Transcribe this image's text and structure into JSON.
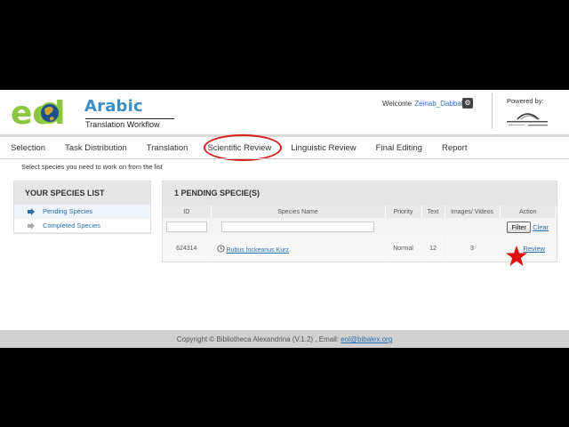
{
  "header": {
    "logo_text": "eol",
    "logo_arabic": "Arabic",
    "logo_subtitle": "Translation Workflow",
    "welcome_label": "Welcome",
    "username": "Zeinab_Dabbah",
    "powered_by": "Powered by:"
  },
  "tabs": [
    {
      "label": "Selection"
    },
    {
      "label": "Task Distribution"
    },
    {
      "label": "Translation"
    },
    {
      "label": "Scientific Review"
    },
    {
      "label": "Linguistic Review"
    },
    {
      "label": "Final Editing"
    },
    {
      "label": "Report"
    }
  ],
  "active_tab": "Scientific Review",
  "instruction": "Select species you need to work on from the list",
  "species_list": {
    "title": "YOUR SPECIES LIST",
    "items": [
      {
        "label": "Pending Species"
      },
      {
        "label": "Completed Species"
      }
    ]
  },
  "pending": {
    "title": "1 PENDING SPECIE(S)",
    "columns": [
      "ID",
      "Species Name",
      "Priority",
      "Text",
      "Images/ Videos",
      "Action"
    ],
    "filter_label": "Filter",
    "clear_label": "Clear",
    "rows": [
      {
        "id": "624314",
        "name": "Rubus fockeanus Kurz",
        "priority": "Normal",
        "text": "12",
        "images": "3",
        "action": "Review"
      }
    ]
  },
  "footer": {
    "copyright": "Copyright © Bibliotheca Alexandrina (V.1.2) , Email:",
    "email": "eol@bibalex.org"
  },
  "colors": {
    "accent_blue": "#2a6fb0",
    "highlight_red": "#d81e1e",
    "logo_green": "#8cc63f"
  }
}
